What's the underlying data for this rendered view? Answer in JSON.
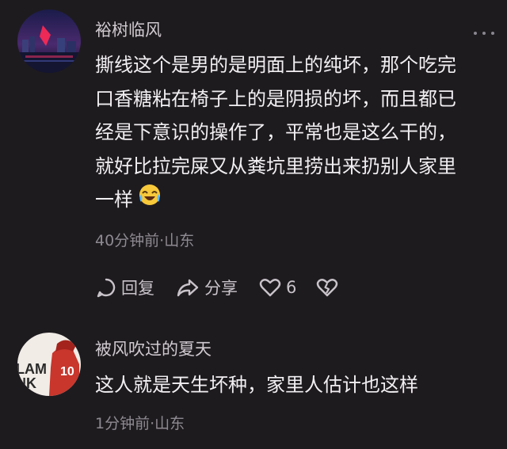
{
  "comments": [
    {
      "username": "裕树临风",
      "lines": [
        "撕线这个是男的是明面上的纯坏，那个吃完",
        "口香糖粘在椅子上的是阴损的坏，而且都已",
        "经是下意识的操作了，平常也是这么干的，",
        "就好比拉完屎又从粪坑里捞出来扔别人家里",
        "一样"
      ],
      "emoji": "crying-laughing-emoji",
      "meta": "40分钟前·山东",
      "actions": {
        "reply_label": "回复",
        "share_label": "分享",
        "like_count": "6"
      }
    },
    {
      "username": "被风吹过的夏天",
      "text": "这人就是天生坏种，家里人估计也这样",
      "meta": "1分钟前·山东"
    }
  ],
  "colors": {
    "background": "#1e1b1f",
    "text": "#f2eff3",
    "meta": "#8e8a91",
    "username": "#cfcacf"
  }
}
